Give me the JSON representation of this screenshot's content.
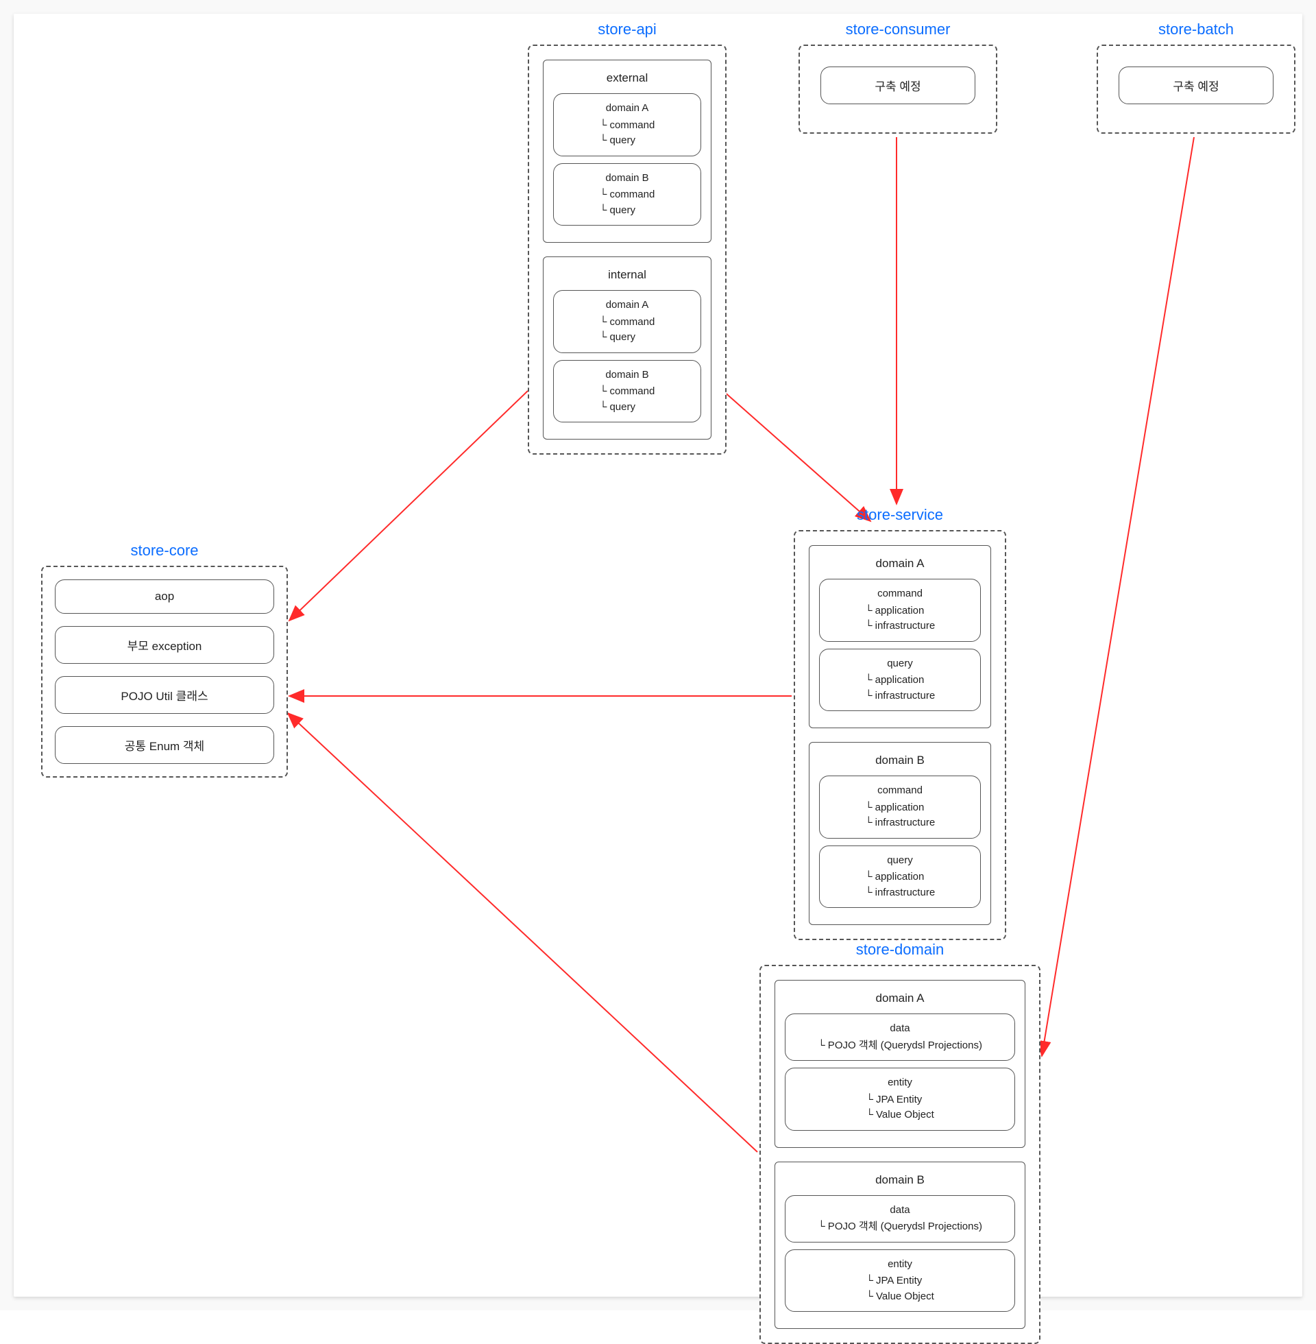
{
  "modules": {
    "store_core": {
      "title": "store-core",
      "items": [
        "aop",
        "부모 exception",
        "POJO Util 클래스",
        "공통 Enum 객체"
      ]
    },
    "store_api": {
      "title": "store-api",
      "sections": [
        {
          "name": "external",
          "domains": [
            {
              "title": "domain A",
              "lines": [
                "└ command",
                "└ query"
              ]
            },
            {
              "title": "domain B",
              "lines": [
                "└ command",
                "└ query"
              ]
            }
          ]
        },
        {
          "name": "internal",
          "domains": [
            {
              "title": "domain A",
              "lines": [
                "└ command",
                "└ query"
              ]
            },
            {
              "title": "domain B",
              "lines": [
                "└ command",
                "└ query"
              ]
            }
          ]
        }
      ]
    },
    "store_consumer": {
      "title": "store-consumer",
      "placeholder": "구축 예정"
    },
    "store_batch": {
      "title": "store-batch",
      "placeholder": "구축 예정"
    },
    "store_service": {
      "title": "store-service",
      "domains": [
        {
          "name": "domain A",
          "blocks": [
            {
              "title": "command",
              "lines": [
                "└ application",
                "└ infrastructure"
              ]
            },
            {
              "title": "query",
              "lines": [
                "└ application",
                "└ infrastructure"
              ]
            }
          ]
        },
        {
          "name": "domain B",
          "blocks": [
            {
              "title": "command",
              "lines": [
                "└ application",
                "└ infrastructure"
              ]
            },
            {
              "title": "query",
              "lines": [
                "└ application",
                "└ infrastructure"
              ]
            }
          ]
        }
      ]
    },
    "store_domain": {
      "title": "store-domain",
      "domains": [
        {
          "name": "domain A",
          "blocks": [
            {
              "title": "data",
              "lines": [
                "└ POJO 객체 (Querydsl Projections)"
              ]
            },
            {
              "title": "entity",
              "lines": [
                "└ JPA Entity",
                "└ Value Object"
              ]
            }
          ]
        },
        {
          "name": "domain B",
          "blocks": [
            {
              "title": "data",
              "lines": [
                "└ POJO 객체 (Querydsl Projections)"
              ]
            },
            {
              "title": "entity",
              "lines": [
                "└ JPA Entity",
                "└ Value Object"
              ]
            }
          ]
        }
      ]
    }
  },
  "arrows": [
    {
      "from": "store-api",
      "to": "store-core"
    },
    {
      "from": "store-api",
      "to": "store-service"
    },
    {
      "from": "store-consumer",
      "to": "store-service"
    },
    {
      "from": "store-batch",
      "to": "store-domain"
    },
    {
      "from": "store-service",
      "to": "store-core"
    },
    {
      "from": "store-service",
      "to": "store-domain"
    },
    {
      "from": "store-domain",
      "to": "store-core"
    }
  ]
}
